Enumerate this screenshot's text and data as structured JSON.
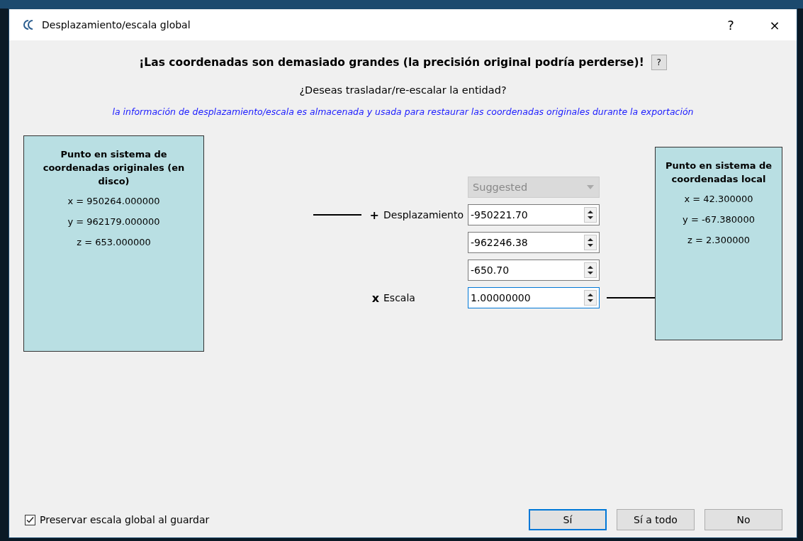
{
  "window": {
    "title": "Desplazamiento/escala global",
    "help_button": "?",
    "close_button": "×"
  },
  "heading": "¡Las coordenadas son demasiado grandes (la precisión original podría perderse)!",
  "heading_help": "?",
  "question": "¿Deseas trasladar/re-escalar la entidad?",
  "info": "la información de desplazamiento/escala es almacenada y usada para restaurar las coordenadas originales durante la exportación",
  "original_point": {
    "title": "Punto en sistema de coordenadas originales (en disco)",
    "lines": [
      "x = 950264.000000",
      "y = 962179.000000",
      "z = 653.000000"
    ]
  },
  "local_point": {
    "title": "Punto en sistema de coordenadas local",
    "lines": [
      "x = 42.300000",
      "y = -67.380000",
      "z = 2.300000"
    ]
  },
  "preset": {
    "value": "Suggested",
    "disabled": true
  },
  "shift": {
    "symbol": "+",
    "label": "Desplazamiento",
    "fields": [
      {
        "value": "-950221.70",
        "focused": false
      },
      {
        "value": "-962246.38",
        "focused": false
      },
      {
        "value": "-650.70",
        "focused": false
      }
    ]
  },
  "scale": {
    "symbol": "x",
    "label": "Escala",
    "field": {
      "value": "1.00000000",
      "focused": true
    }
  },
  "preserve": {
    "label": "Preservar escala global al guardar",
    "checked": true
  },
  "buttons": [
    {
      "label": "Sí",
      "default": true
    },
    {
      "label": "Sí a todo",
      "default": false
    },
    {
      "label": "No",
      "default": false
    }
  ]
}
